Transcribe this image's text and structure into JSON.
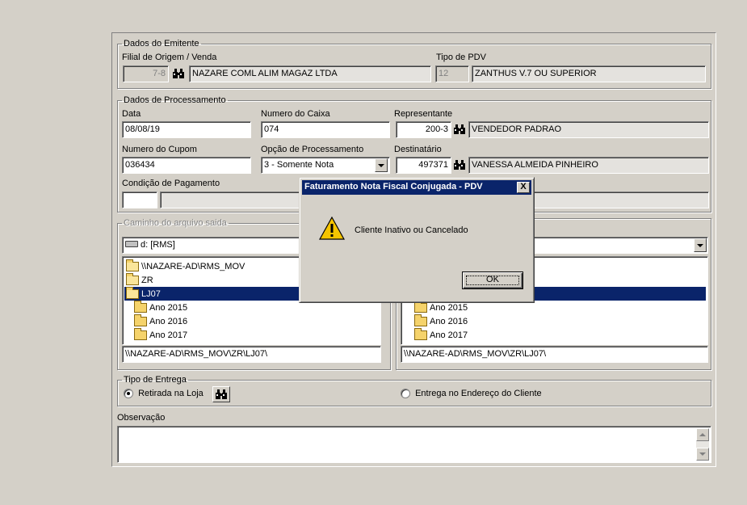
{
  "emitente": {
    "group_title": "Dados do Emitente",
    "filial_label": "Filial de Origem / Venda",
    "filial_code": "7-8",
    "filial_name": "NAZARE COML ALIM MAGAZ LTDA",
    "tipo_pdv_label": "Tipo de PDV",
    "tipo_pdv_code": "12",
    "tipo_pdv_name": "ZANTHUS V.7 OU SUPERIOR"
  },
  "processamento": {
    "group_title": "Dados de Processamento",
    "data_label": "Data",
    "data_value": "08/08/19",
    "caixa_label": "Numero do Caixa",
    "caixa_value": "074",
    "representante_label": "Representante",
    "representante_code": "200-3",
    "representante_name": "VENDEDOR PADRAO",
    "cupom_label": "Numero do Cupom",
    "cupom_value": "036434",
    "opcao_label": "Opção de Processamento",
    "opcao_value": "3 - Somente Nota",
    "destinatario_label": "Destinatário",
    "destinatario_code": "497371",
    "destinatario_name": "VANESSA ALMEIDA PINHEIRO",
    "condicao_label": "Condição de Pagamento",
    "condicao_code": "",
    "condicao_desc": ""
  },
  "caminho": {
    "group_title": "Caminho do arquivo saida",
    "drive": "d: [RMS]",
    "dirs": [
      "\\\\NAZARE-AD\\RMS_MOV",
      "ZR",
      "LJ07",
      "Ano 2015",
      "Ano 2016",
      "Ano 2017"
    ],
    "path": "\\\\NAZARE-AD\\RMS_MOV\\ZR\\LJ07\\"
  },
  "caminho_right": {
    "dirs": [
      "Ano 2015",
      "Ano 2016",
      "Ano 2017"
    ],
    "path": "\\\\NAZARE-AD\\RMS_MOV\\ZR\\LJ07\\"
  },
  "entrega": {
    "group_title": "Tipo de Entrega",
    "option_loja": "Retirada na Loja",
    "option_endereco": "Entrega no Endereço do Cliente",
    "selected": "Retirada na Loja"
  },
  "observacao": {
    "label": "Observação",
    "value": ""
  },
  "dialog": {
    "title": "Faturamento Nota Fiscal Conjugada - PDV",
    "message": "Cliente Inativo ou Cancelado",
    "ok_label": "OK",
    "close_label": "X"
  },
  "icons": {
    "search": "binoculars-icon",
    "warning": "warning-icon",
    "folder": "folder-icon",
    "drive": "drive-icon"
  }
}
